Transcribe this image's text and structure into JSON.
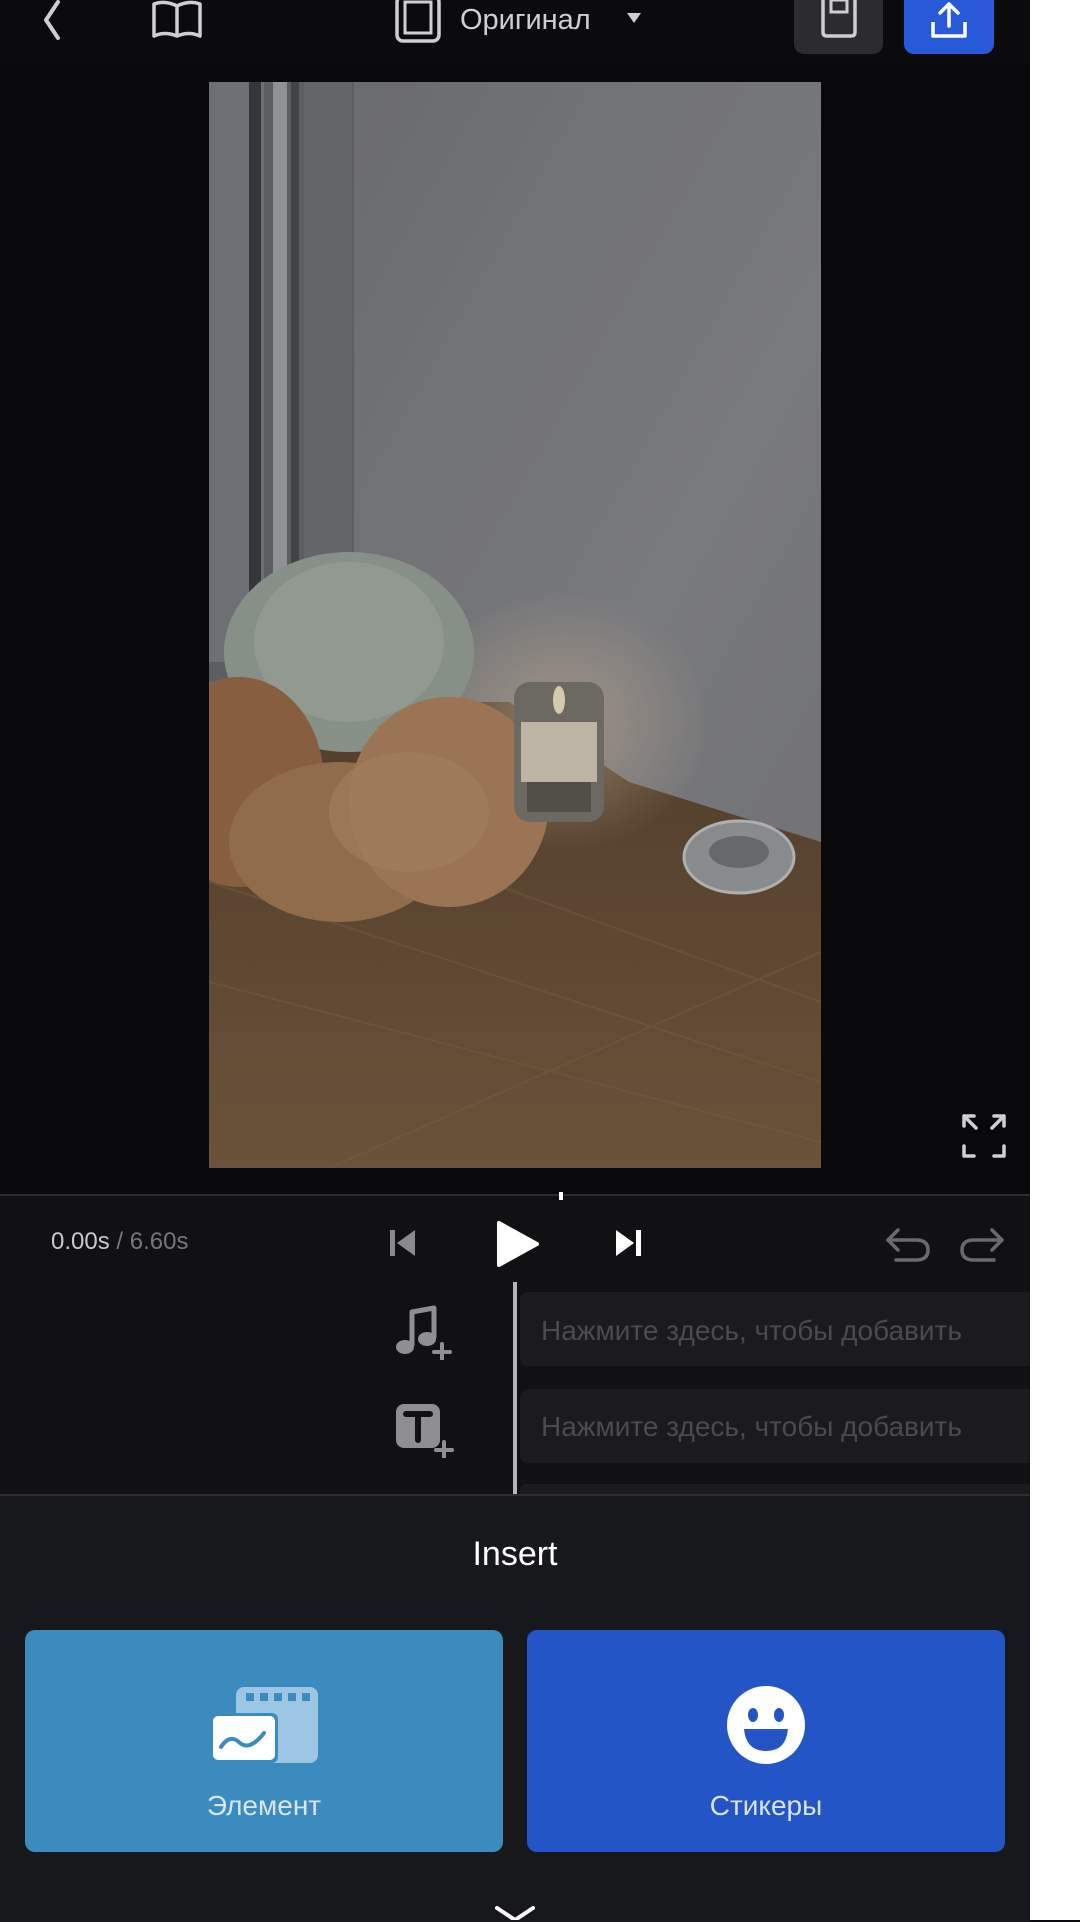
{
  "header": {
    "aspect_label": "Оригинал",
    "icons": [
      "back-icon",
      "book-icon",
      "aspect-ratio-icon",
      "dropdown-icon",
      "save-icon",
      "export-icon"
    ]
  },
  "playback": {
    "current_time": "0.00s",
    "separator": " / ",
    "total_time": "6.60s"
  },
  "timeline": {
    "music_track_placeholder": "Нажмите здесь, чтобы добавить",
    "text_track_placeholder": "Нажмите здесь, чтобы добавить"
  },
  "insert_panel": {
    "title": "Insert",
    "tiles": [
      {
        "label": "Элемент",
        "icon": "media-element-icon",
        "color": "#3b8bbf"
      },
      {
        "label": "Стикеры",
        "icon": "smiley-icon",
        "color": "#2355c7"
      }
    ]
  },
  "colors": {
    "accent": "#2759d8",
    "background": "#0b0b0d",
    "panel": "#17181c"
  }
}
